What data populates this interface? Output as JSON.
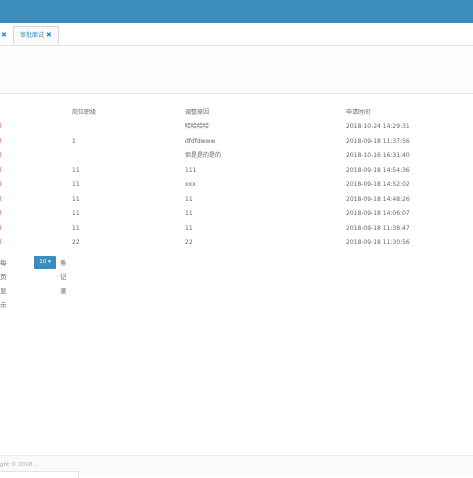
{
  "header": {
    "brand_color": "#3c8dbc"
  },
  "tabs": {
    "partial_tab_label": "",
    "partial_tab_close": "✖",
    "active_tab_label": "审批面试",
    "active_tab_close": "✖"
  },
  "table": {
    "columns": [
      "岗位职级",
      "调整原因",
      "申请时间"
    ],
    "rows": [
      {
        "mark": "l",
        "level": "",
        "reason": "哈哈哈哈",
        "time": "2018-10-24 14:29:31"
      },
      {
        "mark": "l",
        "level": "1",
        "reason": "dfdfdwww",
        "time": "2018-09-18 11:37:56"
      },
      {
        "mark": "l",
        "level": "",
        "reason": "但是是的是的",
        "time": "2018-10-16 16:31:40"
      },
      {
        "mark": "l",
        "level": "11",
        "reason": "111",
        "time": "2018-09-18 14:54:36"
      },
      {
        "mark": "l",
        "level": "11",
        "reason": "xxx",
        "time": "2018-09-18 14:52:02"
      },
      {
        "mark": "l",
        "level": "11",
        "reason": "11",
        "time": "2018-09-18 14:48:26"
      },
      {
        "mark": "l",
        "level": "11",
        "reason": "11",
        "time": "2018-09-18 14:06:07"
      },
      {
        "mark": "l",
        "level": "11",
        "reason": "11",
        "time": "2018-09-18 11:38:47"
      },
      {
        "mark": "l",
        "level": "22",
        "reason": "22",
        "time": "2018-09-18 11:30:56"
      }
    ]
  },
  "pager": {
    "prefix": "每页显示",
    "page_size": "10",
    "caret": "▾",
    "suffix": "条记录"
  },
  "footer": {
    "text": "ght © 2018 ..."
  }
}
